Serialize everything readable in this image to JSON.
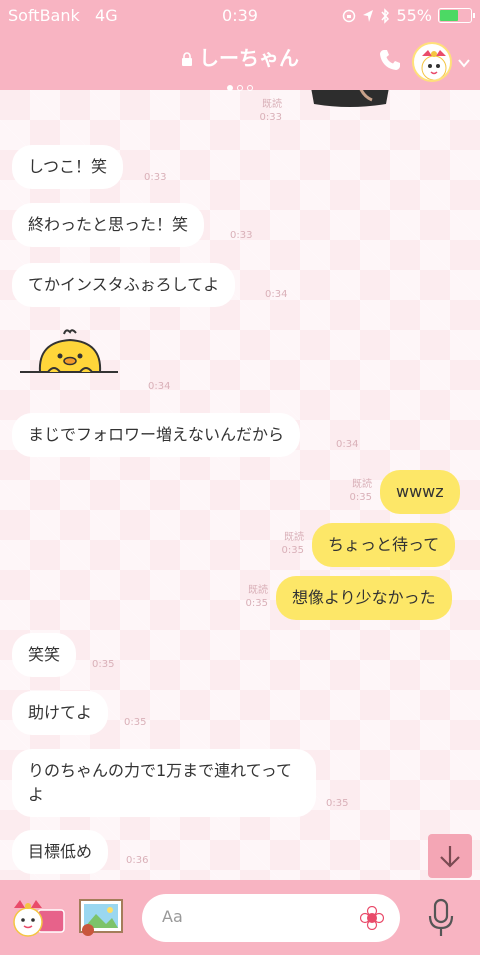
{
  "status_bar": {
    "carrier": "SoftBank",
    "network": "4G",
    "time": "0:39",
    "battery": "55%",
    "battery_level": 0.55
  },
  "header": {
    "title": "しーちゃん"
  },
  "messages": [
    {
      "side": "left",
      "text": "しつこ！笑",
      "time": "0:33"
    },
    {
      "side": "left",
      "text": "終わったと思った！笑",
      "time": "0:33"
    },
    {
      "side": "left",
      "text": "てかインスタふぉろしてよ",
      "time": "0:34"
    },
    {
      "side": "left",
      "text": "",
      "time": "0:34",
      "sticker": "chick-sticker"
    },
    {
      "side": "left",
      "text": "まじでフォロワー増えないんだから",
      "time": "0:34"
    },
    {
      "side": "right",
      "text": "wwwz",
      "time": "0:35",
      "read": "既読"
    },
    {
      "side": "right",
      "text": "ちょっと待って",
      "time": "0:35",
      "read": "既読"
    },
    {
      "side": "right",
      "text": "想像より少なかった",
      "time": "0:35",
      "read": "既読"
    },
    {
      "side": "left",
      "text": "笑笑",
      "time": "0:35"
    },
    {
      "side": "left",
      "text": "助けてよ",
      "time": "0:35"
    },
    {
      "side": "left",
      "text": "りのちゃんの力で1万まで連れてってよ",
      "time": "0:35"
    },
    {
      "side": "left",
      "text": "目標低め",
      "time": "0:36"
    }
  ],
  "top_meta": {
    "read": "既読",
    "time": "0:33"
  },
  "input": {
    "placeholder": "Aa"
  },
  "colors": {
    "header": "#f8b4c2",
    "my_bubble": "#fde768",
    "their_bubble": "#ffffff"
  }
}
